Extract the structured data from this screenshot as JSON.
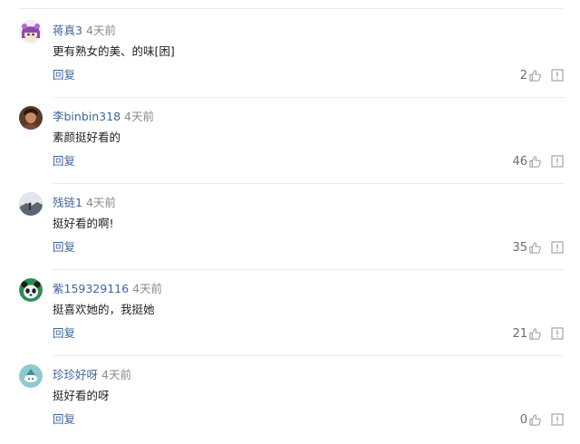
{
  "reply_label": "回复",
  "comments": [
    {
      "username": "蒋真3",
      "time": "4天前",
      "text": "更有熟女的美、的味[困]",
      "likes": "2",
      "avatar_icon": "cartoon-girl-avatar-icon"
    },
    {
      "username": "李binbin318",
      "time": "4天前",
      "text": "素颜挺好看的",
      "likes": "46",
      "avatar_icon": "photo-avatar-icon"
    },
    {
      "username": "残链1",
      "time": "4天前",
      "text": "挺好看的啊!",
      "likes": "35",
      "avatar_icon": "landscape-avatar-icon"
    },
    {
      "username": "紫159329116",
      "time": "4天前",
      "text": "挺喜欢她的，我挺她",
      "likes": "21",
      "avatar_icon": "panda-avatar-icon"
    },
    {
      "username": "珍珍好呀",
      "time": "4天前",
      "text": "挺好看的呀",
      "likes": "0",
      "avatar_icon": "teal-cartoon-avatar-icon"
    }
  ]
}
